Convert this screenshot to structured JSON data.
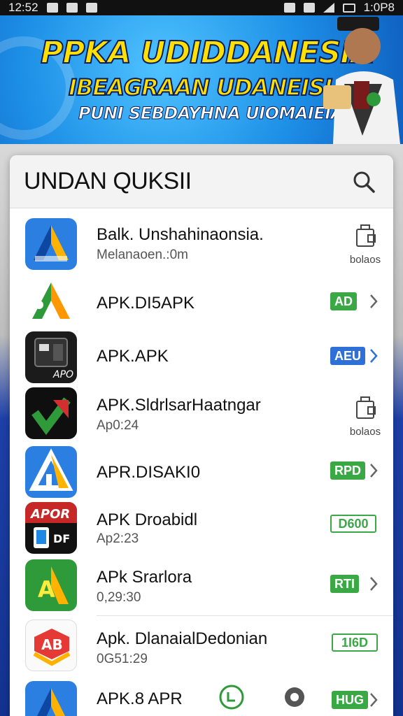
{
  "status_bar": {
    "time": "12:52",
    "right_text": "1:0P8"
  },
  "banner": {
    "line1": "PPKA UDIDDANESIA",
    "line2": "IBEAGRAAN UDANEISI",
    "line3": "PUNI SEBDAYHNA UIOMAIEIAINA"
  },
  "card": {
    "title": "UNDAN  QUKSII"
  },
  "apps": [
    {
      "name": "Balk. Unshahinaonsia.",
      "sub": "Melanaoen.:0m",
      "action": "bag",
      "action_label": "bolaos"
    },
    {
      "name": "APK.DI5APK",
      "sub": "",
      "action": "badge",
      "badge": "AD",
      "badge_color": "green"
    },
    {
      "name": "APK.APK",
      "sub": "",
      "action": "badge",
      "badge": "AEU",
      "badge_color": "blue"
    },
    {
      "name": "APK.SldrlsarHaatngar",
      "sub": "Ap0:24",
      "action": "bag",
      "action_label": "bolaos"
    },
    {
      "name": "APR.DISAKI0",
      "sub": "",
      "action": "badge",
      "badge": "RPD",
      "badge_color": "green"
    },
    {
      "name": "APK Droabidl",
      "sub": "Ap2:23",
      "action": "badge",
      "badge": "D600",
      "badge_color": "outline"
    },
    {
      "name": "APk Srarlora",
      "sub": "0,29:30",
      "action": "badge",
      "badge": "RTI",
      "badge_color": "green"
    },
    {
      "name": "Apk. DlanaialDedonian",
      "sub": "0G51:29",
      "action": "badge",
      "badge": "1I6D",
      "badge_color": "outline"
    },
    {
      "name": "APK.8 APR",
      "sub": "",
      "action": "badge",
      "badge": "HUG",
      "badge_color": "green"
    }
  ],
  "icon_texts": {
    "app3": "APO",
    "app6_top": "APOR",
    "app6_bottom": "DF",
    "app7_letter": "A",
    "app8": "AB"
  },
  "colors": {
    "accent_green": "#3aa845",
    "accent_blue": "#2f6fd8",
    "banner_yellow": "#ffe000"
  }
}
